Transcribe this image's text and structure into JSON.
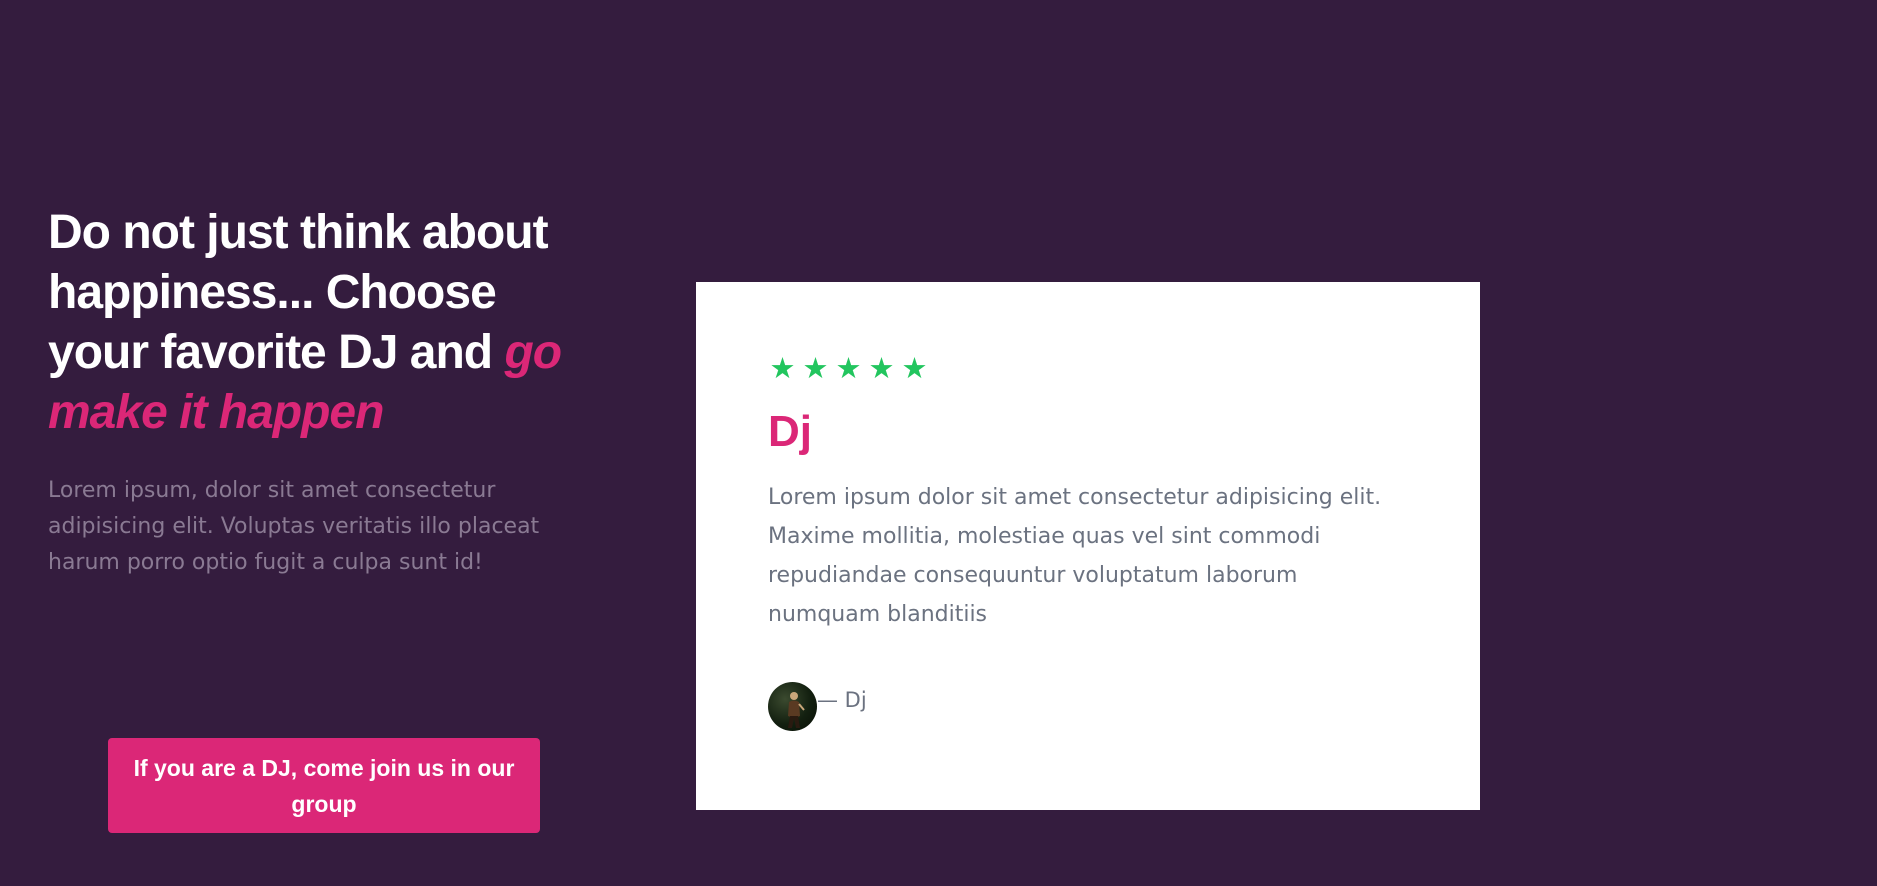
{
  "hero": {
    "headline_plain": "Do not just think about happiness... Choose your favorite DJ and ",
    "headline_accent": "go make it happen",
    "subtext": "Lorem ipsum, dolor sit amet consectetur adipisicing elit. Voluptas veritatis illo placeat harum porro optio fugit a culpa sunt id!",
    "cta_label": "If you are a DJ, come join us in our group"
  },
  "review": {
    "stars": 5,
    "star_glyph": "★",
    "title": "Dj",
    "body": "Lorem ipsum dolor sit amet consectetur adipisicing elit. Maxime mollitia, molestiae quas vel sint commodi repudiandae consequuntur voluptatum laborum numquam blanditiis",
    "reviewer_name": "— Dj",
    "avatar_icon": "dj-avatar-photo"
  },
  "colors": {
    "background": "#341c3e",
    "accent": "#db2777",
    "star": "#22c55e",
    "muted_text": "#8a7a93",
    "card_text": "#6b7280"
  }
}
